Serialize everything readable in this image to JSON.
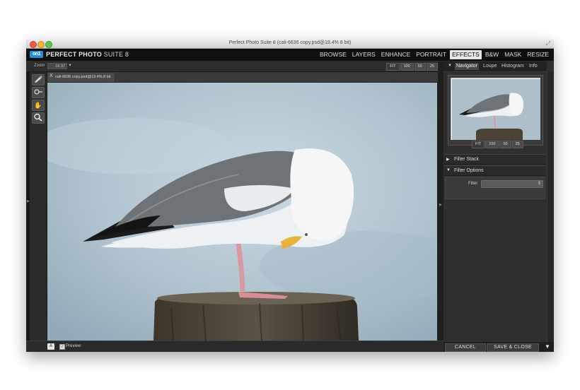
{
  "window": {
    "title": "Perfect Photo Suite 8 (cali-6636 copy.psd@19.4% 8 bit)"
  },
  "app": {
    "logo": "on1",
    "name_bold": "PERFECT PHOTO",
    "name_thin": "SUITE 8"
  },
  "modules": [
    {
      "label": "BROWSE",
      "active": false
    },
    {
      "label": "LAYERS",
      "active": false
    },
    {
      "label": "ENHANCE",
      "active": false
    },
    {
      "label": "PORTRAIT",
      "active": false
    },
    {
      "label": "EFFECTS",
      "active": true
    },
    {
      "label": "B&W",
      "active": false
    },
    {
      "label": "MASK",
      "active": false
    },
    {
      "label": "RESIZE",
      "active": false
    }
  ],
  "zoom": {
    "label": "Zoom",
    "value": "19.37"
  },
  "zoom_buttons": [
    "FIT",
    "100",
    "50",
    "25"
  ],
  "document_tab": {
    "close": "X",
    "name": "cali-6636 copy.psd@19.4% 8 bit"
  },
  "bottom": {
    "a_button": "A",
    "preview_label": "Preview",
    "preview_checked": true
  },
  "right_panel": {
    "tabs": [
      "Navigator",
      "Loupe",
      "Histogram",
      "Info"
    ],
    "active_tab": "Navigator",
    "nav_buttons": [
      "FIT",
      "100",
      "50",
      "25"
    ],
    "filter_stack": "Filter Stack",
    "filter_options": "Filter Options",
    "filter_label": "Filter",
    "filter_value": ""
  },
  "actions": {
    "cancel": "CANCEL",
    "save_close": "SAVE & CLOSE"
  },
  "colors": {
    "accent": "#2d8ad4",
    "panel": "#2f2f2f",
    "background": "#1d1d1d",
    "sky": "#b4c6d1"
  }
}
